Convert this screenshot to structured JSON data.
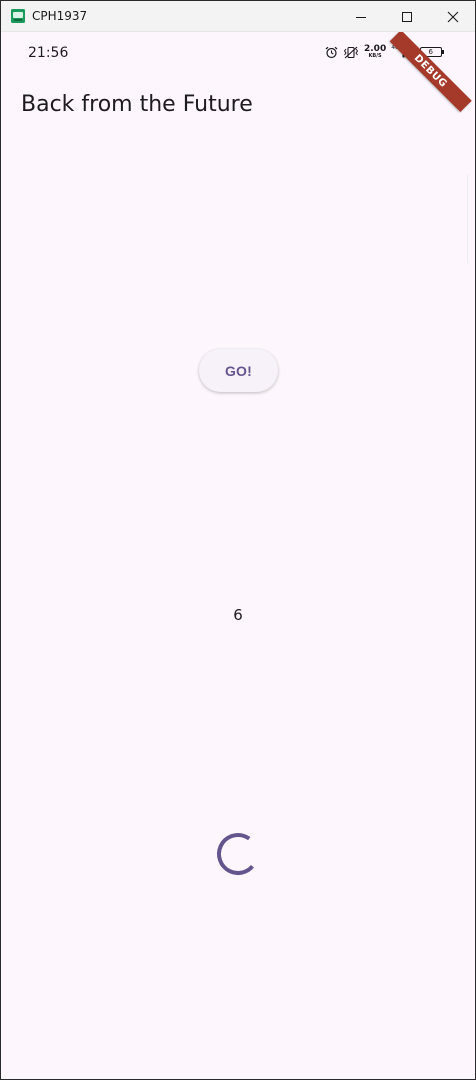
{
  "window": {
    "title": "CPH1937",
    "app_icon": "android-emulator-icon",
    "controls": [
      "minimize-icon",
      "maximize-icon",
      "close-icon"
    ]
  },
  "status_bar": {
    "time": "21:56",
    "icons": [
      "alarm-icon",
      "vibrate-icon",
      "network-speed",
      "4g-signal-icon",
      "battery-icon"
    ],
    "speed_value": "2.00",
    "speed_unit": "KB/S",
    "network_type": "4G",
    "battery_level": "6"
  },
  "debug_banner": {
    "label": "DEBUG",
    "color": "#a5392a"
  },
  "app_bar": {
    "title": "Back from the Future"
  },
  "main": {
    "go_button_label": "GO!",
    "result_value": "6",
    "spinner_icon": "progress-spinner-icon"
  },
  "colors": {
    "background": "#fdf7fd",
    "primary": "#65558f",
    "text": "#1d1b20",
    "button_surface": "#f7f2fa"
  }
}
